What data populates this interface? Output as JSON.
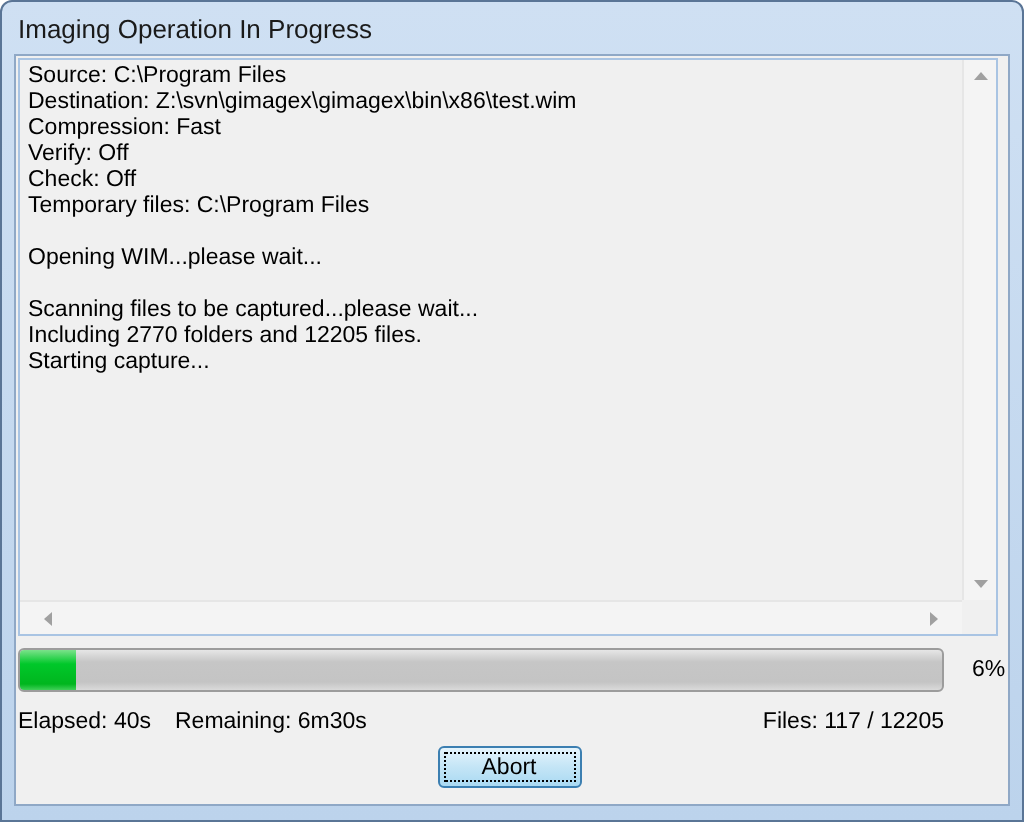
{
  "window": {
    "title": "Imaging Operation In Progress"
  },
  "log": {
    "paragraphs": [
      [
        "Source: C:\\Program Files",
        "Destination: Z:\\svn\\gimagex\\gimagex\\bin\\x86\\test.wim",
        "Compression: Fast",
        "Verify: Off",
        "Check: Off",
        "Temporary files: C:\\Program Files"
      ],
      [
        "Opening WIM...please wait..."
      ],
      [
        "Scanning files to be captured...please wait...",
        "Including 2770 folders and 12205 files.",
        "Starting capture..."
      ]
    ]
  },
  "progress": {
    "level": 0.06,
    "percent": "6%"
  },
  "status": {
    "elapsed": "Elapsed: 40s",
    "remaining": "Remaining: 6m30s",
    "files": "Files: 117 / 12205"
  },
  "buttons": [
    {
      "label": "Abort",
      "default": true
    }
  ]
}
